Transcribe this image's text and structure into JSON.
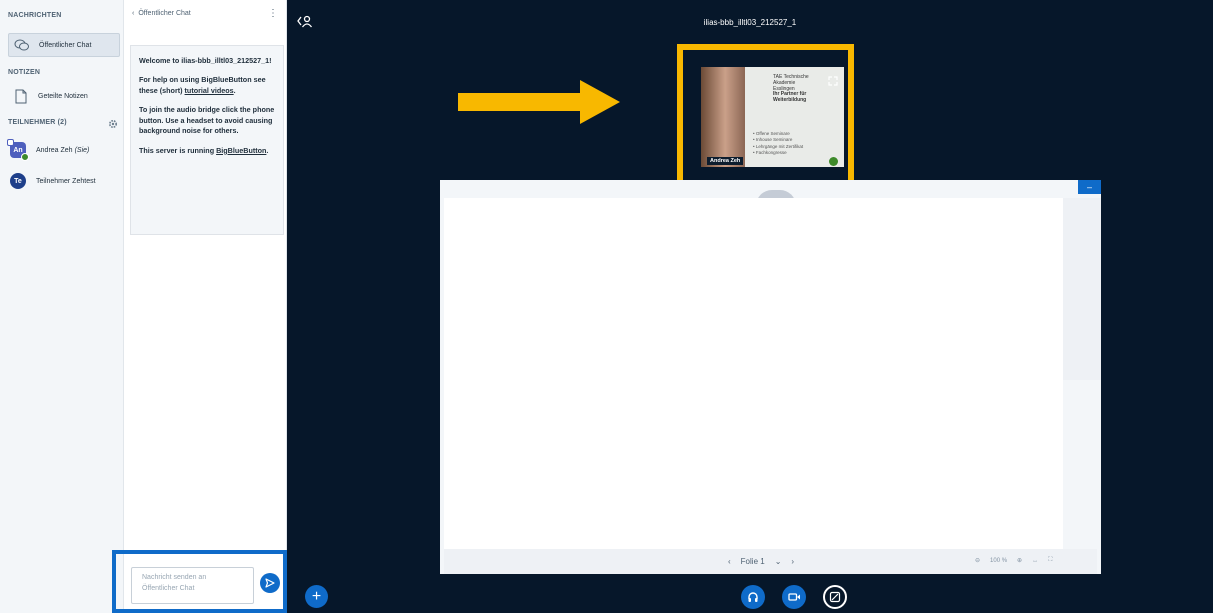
{
  "userlist": {
    "messages_heading": "NACHRICHTEN",
    "public_chat_label": "Öffentlicher Chat",
    "notes_heading": "NOTIZEN",
    "shared_notes_label": "Geteilte Notizen",
    "participants_heading": "TEILNEHMER (2)",
    "users": [
      {
        "initials": "An",
        "name": "Andrea Zeh",
        "suffix": "(Sie)",
        "color": "#4e5fbd"
      },
      {
        "initials": "Te",
        "name": "Teilnehmer Zehtest",
        "suffix": "",
        "color": "#1e3f8a"
      }
    ]
  },
  "chat": {
    "header": "Öffentlicher Chat",
    "welcome_title": "Welcome to ilias-bbb_illtl03_212527_1!",
    "help_pre": "For help on using BigBlueButton see these (short) ",
    "help_link": "tutorial videos",
    "help_post": ".",
    "audio_text": "To join the audio bridge click the phone button. Use a headset to avoid causing background noise for others.",
    "server_pre": "This server is running ",
    "server_link": "BigBlueButton",
    "server_post": ".",
    "input_placeholder_line1": "Nachricht senden an",
    "input_placeholder_line2": "Öffentlicher Chat"
  },
  "stage": {
    "meeting_title": "ilias-bbb_illtl03_212527_1",
    "webcam_name": "Andrea Zeh",
    "webcam_card_lines": [
      "TAE Technische",
      "Akademie",
      "Esslingen",
      "Ihr Partner für",
      "Weiterbildung"
    ],
    "webcam_bullets": [
      "• Offene Seminare",
      "• Inhouse Seminare",
      "• Lehrgänge mit Zertifikat",
      "• Fachkongresse"
    ],
    "slide_label": "Folie 1",
    "zoom_level": "100 %"
  },
  "colors": {
    "accent": "#0f6bc9",
    "highlight": "#f8b800",
    "stage_bg": "#06172a"
  }
}
